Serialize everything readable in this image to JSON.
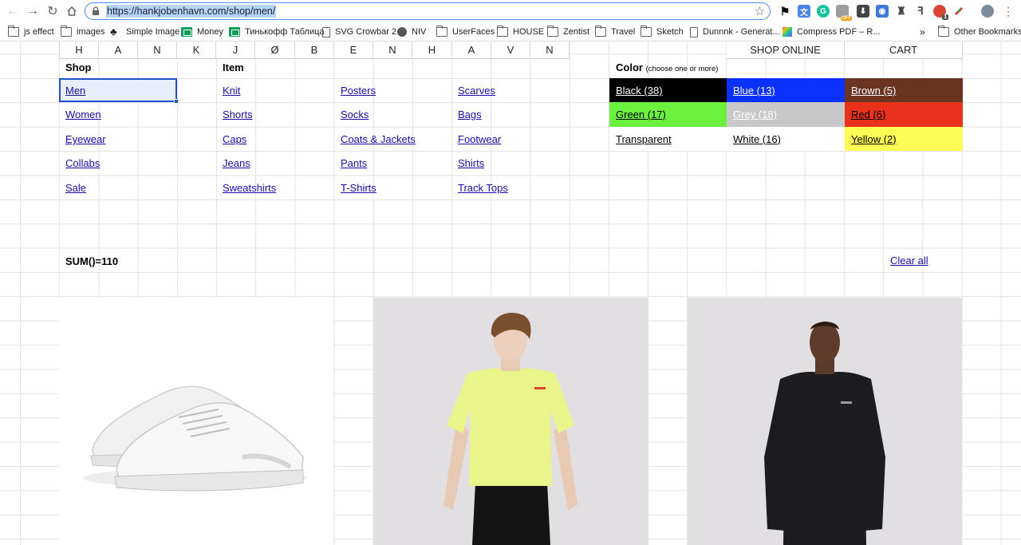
{
  "browser": {
    "url": "https://hankjobenhavn.com/shop/men/",
    "bookmarks": [
      {
        "label": "js effect",
        "icon": "folder-icon"
      },
      {
        "label": "images",
        "icon": "folder-icon"
      },
      {
        "label": "Simple Image",
        "icon": "club-icon"
      },
      {
        "label": "Money",
        "icon": "sheet-icon"
      },
      {
        "label": "Тинькофф Таблица",
        "icon": "sheet-icon"
      },
      {
        "label": "SVG Crowbar 2",
        "icon": "page-icon"
      },
      {
        "label": "NIV",
        "icon": "niv-icon"
      },
      {
        "label": "UserFaces",
        "icon": "folder-icon"
      },
      {
        "label": "HOUSE",
        "icon": "folder-icon"
      },
      {
        "label": "Zentist",
        "icon": "folder-icon"
      },
      {
        "label": "Travel",
        "icon": "folder-icon"
      },
      {
        "label": "Sketch",
        "icon": "folder-icon"
      },
      {
        "label": "Dunnnk - Generat...",
        "icon": "page-icon"
      },
      {
        "label": "Compress PDF – R...",
        "icon": "pdf-icon"
      }
    ],
    "overflow": "»",
    "other_bookmarks": "Other Bookmarks",
    "badge_off": "OFF",
    "badge_count": "1"
  },
  "header": {
    "columns": [
      "H",
      "A",
      "N",
      "K",
      "J",
      "Ø",
      "B",
      "E",
      "N",
      "H",
      "A",
      "V",
      "N"
    ],
    "shop_online": "SHOP ONLINE",
    "cart": "CART"
  },
  "shop": {
    "title": "Shop",
    "items": [
      "Men",
      "Women",
      "Eyewear",
      "Collabs",
      "Sale"
    ],
    "selected": "Men"
  },
  "item": {
    "title": "Item",
    "columns": [
      [
        "Knit",
        "Shorts",
        "Caps",
        "Jeans",
        "Sweatshirts"
      ],
      [
        "Posters",
        "Socks",
        "Coats & Jackets",
        "Pants",
        "T-Shirts"
      ],
      [
        "Scarves",
        "Bags",
        "Footwear",
        "Shirts",
        "Track Tops"
      ]
    ]
  },
  "color": {
    "title": "Color",
    "hint": "(choose one or more)",
    "swatches": [
      {
        "label": "Black (38)",
        "bg": "#000000",
        "fg": "#ffffff"
      },
      {
        "label": "Blue (13)",
        "bg": "#0a31ff",
        "fg": "#ffffff"
      },
      {
        "label": "Brown (5)",
        "bg": "#6b3322",
        "fg": "#ffffff"
      },
      {
        "label": "Green (17)",
        "bg": "#6cf23e",
        "fg": "#000000"
      },
      {
        "label": "Grey (18)",
        "bg": "#c8c8c8",
        "fg": "#ffffff"
      },
      {
        "label": "Red (6)",
        "bg": "#e8321c",
        "fg": "#000000"
      },
      {
        "label": "Transparent",
        "bg": "#ffffff",
        "fg": "#000000"
      },
      {
        "label": "White (16)",
        "bg": "#ffffff",
        "fg": "#000000"
      },
      {
        "label": "Yellow (2)",
        "bg": "#fdfc56",
        "fg": "#000000"
      }
    ]
  },
  "sum": "SUM()=110",
  "clear_all": "Clear all",
  "products": [
    {
      "kind": "sneaker"
    },
    {
      "kind": "t-shirt",
      "tee_color": "#e9f58a"
    },
    {
      "kind": "sweatshirt",
      "sweat_color": "#1c1c1e"
    }
  ]
}
